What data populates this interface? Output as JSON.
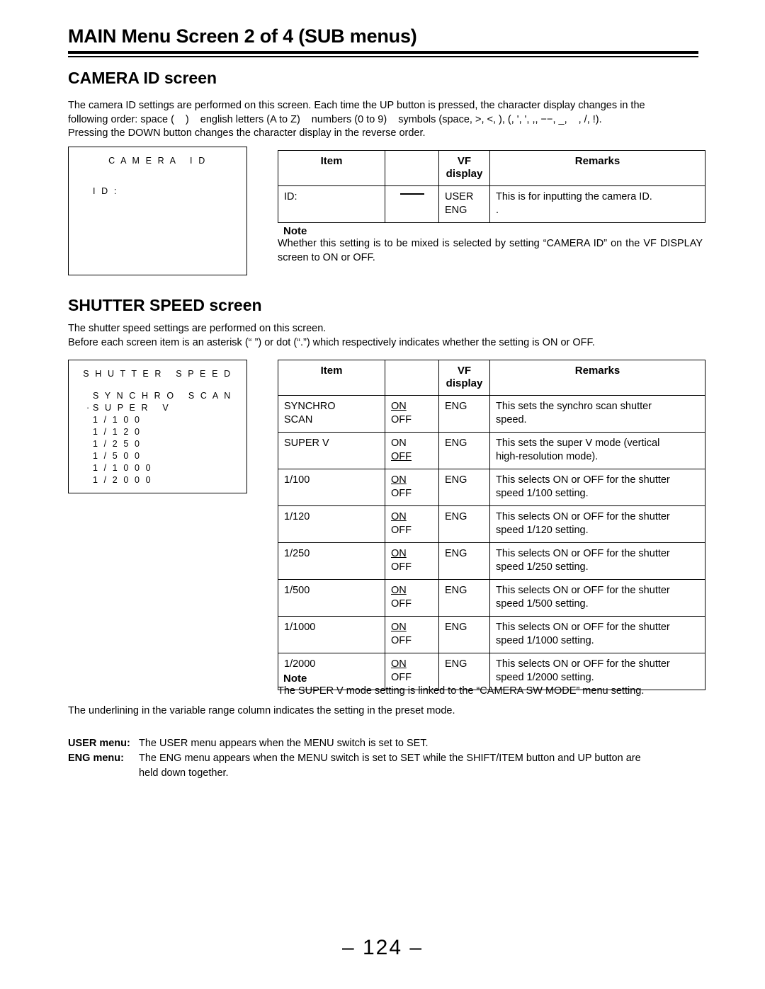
{
  "page": {
    "main_title": "MAIN Menu Screen 2 of 4 (SUB menus)",
    "page_number": "– 124 –"
  },
  "camera_id_section": {
    "title": "CAMERA ID screen",
    "intro_line1": "The camera ID settings are performed on this screen. Each time the UP button is pressed, the character display changes in the",
    "intro_line2_a": "following order: space (",
    "intro_line2_b": ")",
    "intro_line2_c": "english letters (A to Z)",
    "intro_line2_d": "numbers (0 to 9)",
    "intro_line2_e": "symbols (space, >, <, ), (, ', ', ,, −−, _,",
    "intro_line2_f": ", /, !).",
    "intro_line3": "Pressing the DOWN button changes the character display in the reverse order.",
    "screen": {
      "title": "C A M E R A   I D",
      "lines": [
        "I D :"
      ]
    },
    "table": {
      "headers": {
        "item": "Item",
        "range": "",
        "vf_line1": "VF",
        "vf_line2": "display",
        "remarks": "Remarks"
      },
      "rows": [
        {
          "item": "ID:",
          "range": "",
          "range_is_dash": true,
          "vf_line1": "USER",
          "vf_line2": "ENG",
          "remarks_line1": "This is for inputting the camera ID.",
          "remarks_line2": "."
        }
      ]
    },
    "note": {
      "label": "Note",
      "text": "Whether this setting is to be mixed is selected by setting “CAMERA ID” on the VF DISPLAY screen to ON or OFF."
    }
  },
  "shutter_section": {
    "title": "SHUTTER SPEED screen",
    "intro_line1": "The shutter speed settings are performed on this screen.",
    "intro_line2": "Before each screen item is an asterisk (“  ”) or dot (“.”) which respectively indicates whether the setting is ON or OFF.",
    "screen": {
      "title": "S H U T T E R   S P E E D",
      "lines": [
        {
          "text": "S Y N C H R O   S C A N",
          "marker": ""
        },
        {
          "text": "S U P E R   V",
          "marker": "·"
        },
        {
          "text": "1 / 1 0 0",
          "marker": ""
        },
        {
          "text": "1 / 1 2 0",
          "marker": ""
        },
        {
          "text": "1 / 2 5 0",
          "marker": ""
        },
        {
          "text": "1 / 5 0 0",
          "marker": ""
        },
        {
          "text": "1 / 1 0 0 0",
          "marker": ""
        },
        {
          "text": "1 / 2 0 0 0",
          "marker": ""
        }
      ]
    },
    "table": {
      "headers": {
        "item": "Item",
        "range": "",
        "vf_line1": "VF",
        "vf_line2": "display",
        "remarks": "Remarks"
      },
      "rows": [
        {
          "item_line1": "SYNCHRO",
          "item_line2": "SCAN",
          "on": "ON",
          "off": "OFF",
          "underlined": "ON",
          "vf": "ENG",
          "remarks_line1": "This sets the synchro scan shutter",
          "remarks_line2": "speed."
        },
        {
          "item_line1": "SUPER V",
          "item_line2": "",
          "on": "ON",
          "off": "OFF",
          "underlined": "OFF",
          "vf": "ENG",
          "remarks_line1": "This sets the super V mode (vertical",
          "remarks_line2": "high-resolution mode)."
        },
        {
          "item_line1": "1/100",
          "item_line2": "",
          "on": "ON",
          "off": "OFF",
          "underlined": "ON",
          "vf": "ENG",
          "remarks_line1": "This selects ON or OFF for the shutter",
          "remarks_line2": "speed 1/100 setting."
        },
        {
          "item_line1": "1/120",
          "item_line2": "",
          "on": "ON",
          "off": "OFF",
          "underlined": "ON",
          "vf": "ENG",
          "remarks_line1": "This selects ON or OFF for the shutter",
          "remarks_line2": "speed 1/120 setting."
        },
        {
          "item_line1": "1/250",
          "item_line2": "",
          "on": "ON",
          "off": "OFF",
          "underlined": "ON",
          "vf": "ENG",
          "remarks_line1": "This selects ON or OFF for the shutter",
          "remarks_line2": "speed 1/250 setting."
        },
        {
          "item_line1": "1/500",
          "item_line2": "",
          "on": "ON",
          "off": "OFF",
          "underlined": "ON",
          "vf": "ENG",
          "remarks_line1": "This selects ON or OFF for the shutter",
          "remarks_line2": "speed 1/500 setting."
        },
        {
          "item_line1": "1/1000",
          "item_line2": "",
          "on": "ON",
          "off": "OFF",
          "underlined": "ON",
          "vf": "ENG",
          "remarks_line1": "This selects ON or OFF for the shutter",
          "remarks_line2": "speed 1/1000 setting."
        },
        {
          "item_line1": "1/2000",
          "item_line2": "",
          "on": "ON",
          "off": "OFF",
          "underlined": "ON",
          "vf": "ENG",
          "remarks_line1": "This selects ON or OFF for the shutter",
          "remarks_line2": "speed 1/2000 setting."
        }
      ]
    },
    "note": {
      "label": "Note",
      "text": "The SUPER V mode setting is linked to the “CAMERA SW MODE” menu setting."
    }
  },
  "footer": {
    "underline_note": "The underlining in the variable range column indicates the setting in the preset mode.",
    "user_menu_key": "USER menu:",
    "user_menu_val": "The USER menu appears when the MENU switch is set to SET.",
    "eng_menu_key": "ENG menu:",
    "eng_menu_val": "The ENG menu appears when the MENU switch is set to SET while the SHIFT/ITEM button and UP button are",
    "eng_menu_val2": "held down together."
  }
}
